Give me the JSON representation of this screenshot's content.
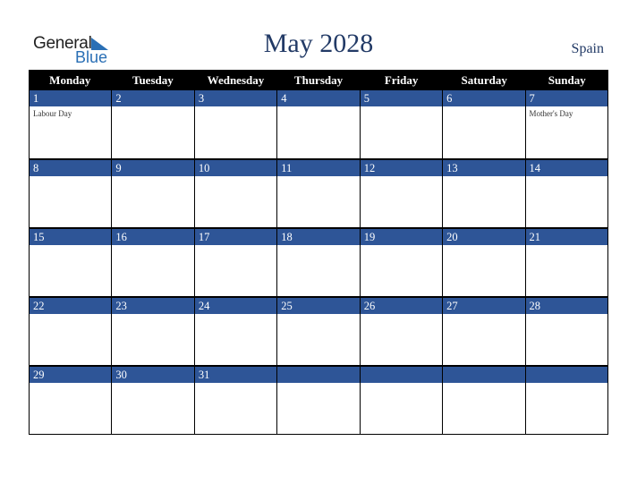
{
  "logo": {
    "line1": "General",
    "line2": "Blue"
  },
  "title": "May 2028",
  "country": "Spain",
  "colors": {
    "header_bg": "#000000",
    "date_bar": "#2e5597",
    "title_text": "#223a66",
    "logo_blue": "#2a6fb5"
  },
  "weekdays": [
    "Monday",
    "Tuesday",
    "Wednesday",
    "Thursday",
    "Friday",
    "Saturday",
    "Sunday"
  ],
  "weeks": [
    [
      {
        "day": "1",
        "event": "Labour Day"
      },
      {
        "day": "2",
        "event": ""
      },
      {
        "day": "3",
        "event": ""
      },
      {
        "day": "4",
        "event": ""
      },
      {
        "day": "5",
        "event": ""
      },
      {
        "day": "6",
        "event": ""
      },
      {
        "day": "7",
        "event": "Mother's Day"
      }
    ],
    [
      {
        "day": "8",
        "event": ""
      },
      {
        "day": "9",
        "event": ""
      },
      {
        "day": "10",
        "event": ""
      },
      {
        "day": "11",
        "event": ""
      },
      {
        "day": "12",
        "event": ""
      },
      {
        "day": "13",
        "event": ""
      },
      {
        "day": "14",
        "event": ""
      }
    ],
    [
      {
        "day": "15",
        "event": ""
      },
      {
        "day": "16",
        "event": ""
      },
      {
        "day": "17",
        "event": ""
      },
      {
        "day": "18",
        "event": ""
      },
      {
        "day": "19",
        "event": ""
      },
      {
        "day": "20",
        "event": ""
      },
      {
        "day": "21",
        "event": ""
      }
    ],
    [
      {
        "day": "22",
        "event": ""
      },
      {
        "day": "23",
        "event": ""
      },
      {
        "day": "24",
        "event": ""
      },
      {
        "day": "25",
        "event": ""
      },
      {
        "day": "26",
        "event": ""
      },
      {
        "day": "27",
        "event": ""
      },
      {
        "day": "28",
        "event": ""
      }
    ],
    [
      {
        "day": "29",
        "event": ""
      },
      {
        "day": "30",
        "event": ""
      },
      {
        "day": "31",
        "event": ""
      },
      {
        "day": "",
        "event": ""
      },
      {
        "day": "",
        "event": ""
      },
      {
        "day": "",
        "event": ""
      },
      {
        "day": "",
        "event": ""
      }
    ]
  ]
}
